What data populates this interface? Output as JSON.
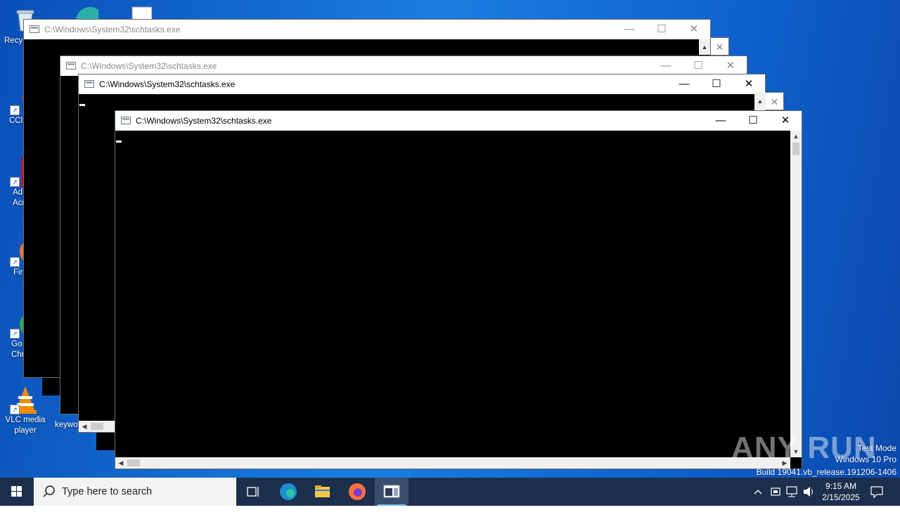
{
  "desktop": {
    "icons": [
      {
        "name": "recycle-bin",
        "label": "Recy"
      },
      {
        "name": "ccleaner",
        "label": "CCl"
      },
      {
        "name": "adobe-acrobat",
        "label": "Ad\nAcr"
      },
      {
        "name": "firefox",
        "label": "Fir"
      },
      {
        "name": "google-chrome",
        "label": "Go\nChr"
      },
      {
        "name": "vlc",
        "label": "VLC media\nplayer"
      },
      {
        "name": "keyword-file",
        "label": "keywo"
      }
    ]
  },
  "windows": [
    {
      "title": "C:\\Windows\\System32\\schtasks.exe"
    },
    {
      "title": "C:\\Windows\\System32\\schtasks.exe"
    },
    {
      "title": "C:\\Windows\\System32\\schtasks.exe"
    },
    {
      "title": "C:\\Windows\\System32\\schtasks.exe"
    }
  ],
  "caption_buttons": {
    "minimize": "—",
    "maximize": "☐",
    "close": "✕"
  },
  "watermark": {
    "brand": "ANY RUN",
    "line1": "Test Mode",
    "line2": "Windows 10 Pro",
    "line3": "Build 19041.vb_release.191206-1406"
  },
  "taskbar": {
    "search_placeholder": "Type here to search",
    "pinned": [
      "task-view",
      "edge",
      "file-explorer",
      "firefox",
      "console"
    ],
    "time": "9:15 AM",
    "date": "2/15/2025"
  },
  "colors": {
    "desktop": "#1a7ee0",
    "taskbar": "#1c2f4c",
    "console": "#000000"
  }
}
